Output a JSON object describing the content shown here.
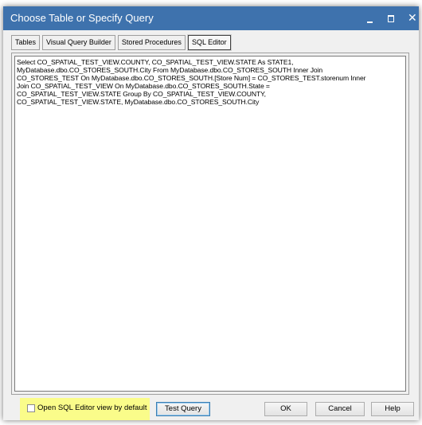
{
  "window": {
    "title": "Choose Table or Specify Query"
  },
  "tabs": [
    {
      "label": "Tables"
    },
    {
      "label": "Visual Query Builder"
    },
    {
      "label": "Stored Procedures"
    },
    {
      "label": "SQL Editor",
      "active": true
    }
  ],
  "editor": {
    "sql": "Select CO_SPATIAL_TEST_VIEW.COUNTY, CO_SPATIAL_TEST_VIEW.STATE As STATE1,\nMyDatabase.dbo.CO_STORES_SOUTH.City From MyDatabase.dbo.CO_STORES_SOUTH Inner Join\nCO_STORES_TEST On MyDatabase.dbo.CO_STORES_SOUTH.[Store Num] = CO_STORES_TEST.storenum Inner\nJoin CO_SPATIAL_TEST_VIEW On MyDatabase.dbo.CO_STORES_SOUTH.State =\nCO_SPATIAL_TEST_VIEW.STATE Group By CO_SPATIAL_TEST_VIEW.COUNTY,\nCO_SPATIAL_TEST_VIEW.STATE, MyDatabase.dbo.CO_STORES_SOUTH.City"
  },
  "footer": {
    "checkbox_label": "Open SQL Editor view by default",
    "checkbox_checked": false,
    "test_query_label": "Test Query",
    "ok_label": "OK",
    "cancel_label": "Cancel",
    "help_label": "Help"
  },
  "colors": {
    "titlebar": "#3e72ad",
    "highlight": "#fafc8a"
  }
}
